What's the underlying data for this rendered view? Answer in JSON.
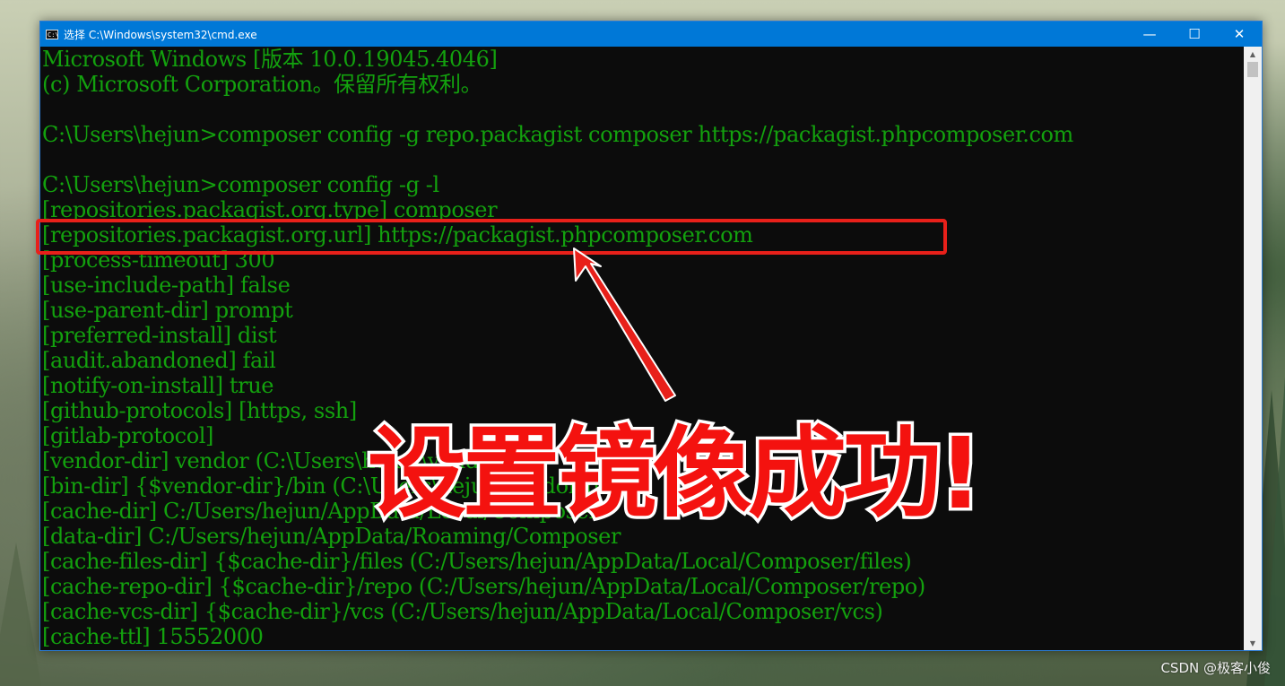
{
  "window": {
    "title": "选择 C:\\Windows\\system32\\cmd.exe",
    "icon": "cmd-icon",
    "minimize": "—",
    "maximize": "☐",
    "close": "✕"
  },
  "terminal": {
    "lines": [
      "Microsoft Windows [版本 10.0.19045.4046]",
      "(c) Microsoft Corporation。保留所有权利。",
      "",
      "C:\\Users\\hejun>composer config -g repo.packagist composer https://packagist.phpcomposer.com",
      "",
      "C:\\Users\\hejun>composer config -g -l",
      "[repositories.packagist.org.type] composer",
      "[repositories.packagist.org.url] https://packagist.phpcomposer.com",
      "[process-timeout] 300",
      "[use-include-path] false",
      "[use-parent-dir] prompt",
      "[preferred-install] dist",
      "[audit.abandoned] fail",
      "[notify-on-install] true",
      "[github-protocols] [https, ssh]",
      "[gitlab-protocol]",
      "[vendor-dir] vendor (C:\\Users\\hejun\\vendor)",
      "[bin-dir] {$vendor-dir}/bin (C:\\Users\\hejun\\vendor/bin)",
      "[cache-dir] C:/Users/hejun/AppData/Local/Composer",
      "[data-dir] C:/Users/hejun/AppData/Roaming/Composer",
      "[cache-files-dir] {$cache-dir}/files (C:/Users/hejun/AppData/Local/Composer/files)",
      "[cache-repo-dir] {$cache-dir}/repo (C:/Users/hejun/AppData/Local/Composer/repo)",
      "[cache-vcs-dir] {$cache-dir}/vcs (C:/Users/hejun/AppData/Local/Composer/vcs)",
      "[cache-ttl] 15552000"
    ],
    "text_color": "#13A10E",
    "background": "#0C0C0C"
  },
  "annotation": {
    "caption": "设置镜像成功!",
    "color": "#F4120F"
  },
  "watermark": "CSDN @极客小俊"
}
